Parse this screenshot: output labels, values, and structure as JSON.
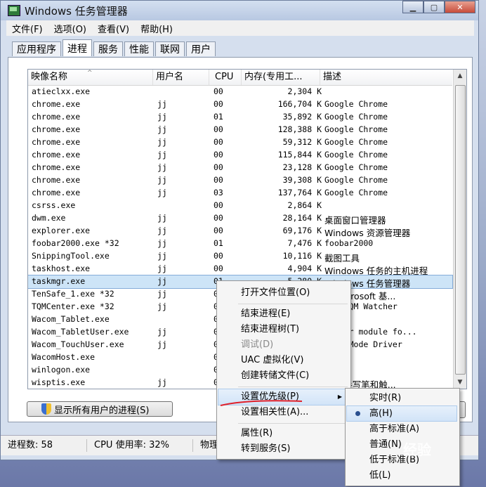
{
  "window": {
    "title": "Windows 任务管理器"
  },
  "menubar": [
    "文件(F)",
    "选项(O)",
    "查看(V)",
    "帮助(H)"
  ],
  "tabs": [
    "应用程序",
    "进程",
    "服务",
    "性能",
    "联网",
    "用户"
  ],
  "active_tab": 1,
  "columns": {
    "name": "映像名称",
    "user": "用户名",
    "cpu": "CPU",
    "mem": "内存(专用工...",
    "desc": "描述"
  },
  "processes": [
    {
      "name": "atieclxx.exe",
      "user": "",
      "cpu": "00",
      "mem": "2,304 K",
      "desc": ""
    },
    {
      "name": "chrome.exe",
      "user": "jj",
      "cpu": "00",
      "mem": "166,704 K",
      "desc": "Google Chrome"
    },
    {
      "name": "chrome.exe",
      "user": "jj",
      "cpu": "01",
      "mem": "35,892 K",
      "desc": "Google Chrome"
    },
    {
      "name": "chrome.exe",
      "user": "jj",
      "cpu": "00",
      "mem": "128,388 K",
      "desc": "Google Chrome"
    },
    {
      "name": "chrome.exe",
      "user": "jj",
      "cpu": "00",
      "mem": "59,312 K",
      "desc": "Google Chrome"
    },
    {
      "name": "chrome.exe",
      "user": "jj",
      "cpu": "00",
      "mem": "115,844 K",
      "desc": "Google Chrome"
    },
    {
      "name": "chrome.exe",
      "user": "jj",
      "cpu": "00",
      "mem": "23,128 K",
      "desc": "Google Chrome"
    },
    {
      "name": "chrome.exe",
      "user": "jj",
      "cpu": "00",
      "mem": "39,308 K",
      "desc": "Google Chrome"
    },
    {
      "name": "chrome.exe",
      "user": "jj",
      "cpu": "03",
      "mem": "137,764 K",
      "desc": "Google Chrome"
    },
    {
      "name": "csrss.exe",
      "user": "",
      "cpu": "00",
      "mem": "2,864 K",
      "desc": ""
    },
    {
      "name": "dwm.exe",
      "user": "jj",
      "cpu": "00",
      "mem": "28,164 K",
      "desc": "桌面窗口管理器"
    },
    {
      "name": "explorer.exe",
      "user": "jj",
      "cpu": "00",
      "mem": "69,176 K",
      "desc": "Windows 资源管理器"
    },
    {
      "name": "foobar2000.exe *32",
      "user": "jj",
      "cpu": "01",
      "mem": "7,476 K",
      "desc": "foobar2000"
    },
    {
      "name": "SnippingTool.exe",
      "user": "jj",
      "cpu": "00",
      "mem": "10,116 K",
      "desc": "截图工具"
    },
    {
      "name": "taskhost.exe",
      "user": "jj",
      "cpu": "00",
      "mem": "4,904 K",
      "desc": "Windows 任务的主机进程"
    },
    {
      "name": "taskmgr.exe",
      "user": "jj",
      "cpu": "01",
      "mem": "5,280 K",
      "desc": "Windows 任务管理器",
      "selected": true
    },
    {
      "name": "TenSafe_1.exe *32",
      "user": "jj",
      "cpu": "0",
      "mem": "",
      "desc": "fe Microsoft 基..."
    },
    {
      "name": "TQMCenter.exe *32",
      "user": "jj",
      "cpu": "0",
      "mem": "",
      "desc": "aby TQM Watcher"
    },
    {
      "name": "Wacom_Tablet.exe",
      "user": "",
      "cpu": "0",
      "mem": "",
      "desc": ""
    },
    {
      "name": "Wacom_TabletUser.exe",
      "user": "jj",
      "cpu": "0",
      "mem": "",
      "desc": "t user module fo..."
    },
    {
      "name": "Wacom_TouchUser.exe",
      "user": "jj",
      "cpu": "0",
      "mem": "",
      "desc": "User Mode Driver"
    },
    {
      "name": "WacomHost.exe",
      "user": "",
      "cpu": "0",
      "mem": "",
      "desc": ""
    },
    {
      "name": "winlogon.exe",
      "user": "",
      "cpu": "0",
      "mem": "",
      "desc": ""
    },
    {
      "name": "wisptis.exe",
      "user": "jj",
      "cpu": "0",
      "mem": "",
      "desc": "soft 手写笔和触..."
    }
  ],
  "show_all_button": "显示所有用户的进程(S)",
  "status": {
    "processes": "进程数: 58",
    "cpu": "CPU 使用率: 32%",
    "memory": "物理"
  },
  "context_menu": {
    "open_location": "打开文件位置(O)",
    "end_process": "结束进程(E)",
    "end_tree": "结束进程树(T)",
    "debug": "调试(D)",
    "uac": "UAC 虚拟化(V)",
    "dump": "创建转储文件(C)",
    "priority": "设置优先级(P)",
    "affinity": "设置相关性(A)...",
    "properties": "属性(R)",
    "goto_service": "转到服务(S)"
  },
  "priority_menu": {
    "items": [
      "实时(R)",
      "高(H)",
      "高于标准(A)",
      "普通(N)",
      "低于标准(B)",
      "低(L)"
    ],
    "selected": 1
  },
  "watermark": "经验",
  "colors": {
    "selection": "#cde4f7",
    "highlight": "#d2e4f8",
    "underline": "#e0202a"
  }
}
